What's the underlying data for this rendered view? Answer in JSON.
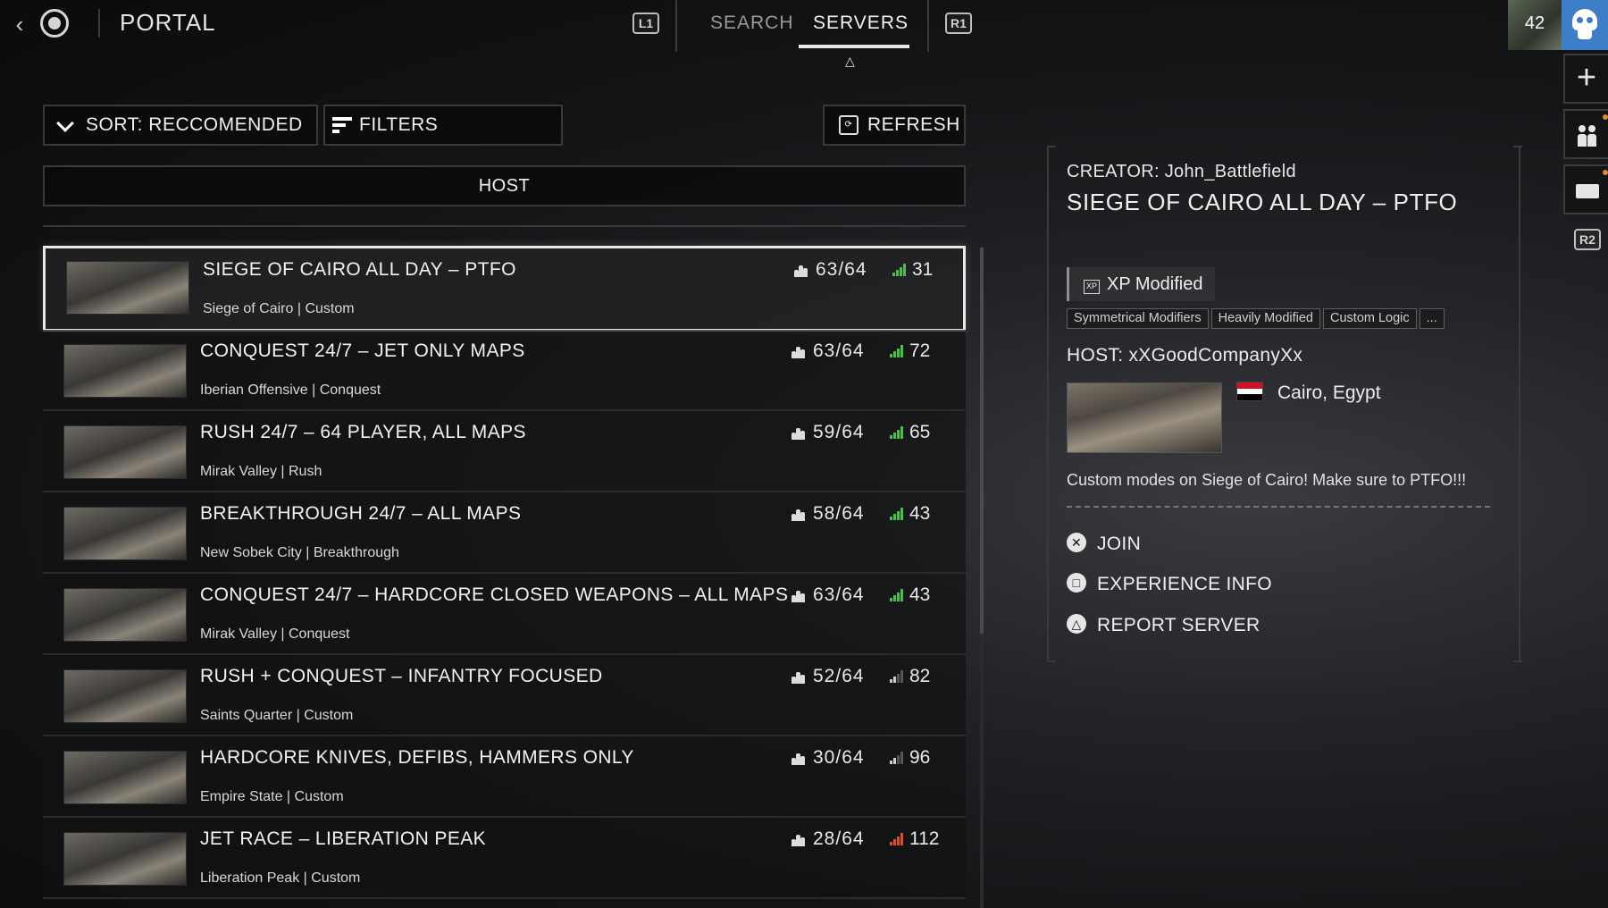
{
  "topbar": {
    "title": "PORTAL",
    "l1": "L1",
    "r1": "R1",
    "tabs": [
      {
        "label": "SEARCH",
        "active": false
      },
      {
        "label": "SERVERS",
        "active": true
      }
    ]
  },
  "rail": {
    "rank": "42",
    "plus": "+",
    "r2": "R2"
  },
  "toolbar": {
    "sort_label": "SORT: RECCOMENDED",
    "filters_label": "FILTERS",
    "refresh_label": "REFRESH"
  },
  "host_bar": "HOST",
  "servers": [
    {
      "name": "SIEGE OF CAIRO ALL DAY – PTFO",
      "sub": "Siege of Cairo | Custom",
      "players": "63/64",
      "ping": "31",
      "ping_color": "#49c049",
      "selected": true
    },
    {
      "name": "CONQUEST 24/7 – JET ONLY MAPS",
      "sub": "Iberian Offensive | Conquest",
      "players": "63/64",
      "ping": "72",
      "ping_color": "#49c049"
    },
    {
      "name": "RUSH 24/7 – 64  PLAYER, ALL MAPS",
      "sub": "Mirak Valley | Rush",
      "players": "59/64",
      "ping": "65",
      "ping_color": "#49c049"
    },
    {
      "name": "BREAKTHROUGH 24/7 – ALL MAPS",
      "sub": "New Sobek City | Breakthrough",
      "players": "58/64",
      "ping": "43",
      "ping_color": "#49c049"
    },
    {
      "name": "CONQUEST 24/7 – HARDCORE CLOSED WEAPONS – ALL MAPS",
      "sub": "Mirak Valley | Conquest",
      "players": "63/64",
      "ping": "43",
      "ping_color": "#49c049"
    },
    {
      "name": "RUSH + CONQUEST – INFANTRY FOCUSED",
      "sub": "Saints Quarter | Custom",
      "players": "52/64",
      "ping": "82",
      "ping_color": "#cfcfcf"
    },
    {
      "name": "HARDCORE KNIVES, DEFIBS, HAMMERS ONLY",
      "sub": "Empire State | Custom",
      "players": "30/64",
      "ping": "96",
      "ping_color": "#cfcfcf"
    },
    {
      "name": "JET RACE – LIBERATION PEAK",
      "sub": "Liberation Peak | Custom",
      "players": "28/64",
      "ping": "112",
      "ping_color": "#d9502e"
    }
  ],
  "detail": {
    "creator": "CREATOR:  John_Battlefield",
    "title": "SIEGE OF CAIRO ALL DAY – PTFO",
    "xp_icon": "XP",
    "xp_label": "XP Modified",
    "chips": [
      "Symmetrical Modifiers",
      "Heavily Modified",
      "Custom Logic",
      "..."
    ],
    "host": "HOST:  xXGoodCompanyXx",
    "location": "Cairo, Egypt",
    "flag_colors": [
      "#ce1126",
      "#ffffff",
      "#000000"
    ],
    "description": "Custom modes on Siege of Cairo! Make sure to PTFO!!!",
    "actions": {
      "join": "JOIN",
      "info": "EXPERIENCE INFO",
      "report": "REPORT SERVER"
    }
  }
}
